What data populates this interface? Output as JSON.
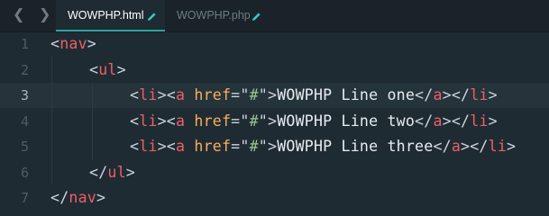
{
  "tabs": [
    {
      "label": "WOWPHP.html",
      "active": true
    },
    {
      "label": "WOWPHP.php",
      "active": false
    }
  ],
  "nav": {
    "back_icon": "chevron-left",
    "forward_icon": "chevron-right"
  },
  "gutter": {
    "lines": [
      "1",
      "2",
      "3",
      "4",
      "5",
      "6",
      "7"
    ],
    "current_line": 3
  },
  "code": {
    "line1": {
      "open": "<",
      "tag": "nav",
      "close": ">"
    },
    "line2": {
      "open": "<",
      "tag": "ul",
      "close": ">"
    },
    "line3": {
      "li_open": "<",
      "li": "li",
      "li_close": ">",
      "a_open": "<",
      "a": "a",
      "attr": "href",
      "eq": "=",
      "q1": "\"",
      "val": "#",
      "q2": "\"",
      "gt": ">",
      "text": "WOWPHP Line one",
      "a_end_open": "</",
      "a_end": "a",
      "a_end_close": ">",
      "li_end_open": "</",
      "li_end": "li",
      "li_end_close": ">"
    },
    "line4": {
      "li_open": "<",
      "li": "li",
      "li_close": ">",
      "a_open": "<",
      "a": "a",
      "attr": "href",
      "eq": "=",
      "q1": "\"",
      "val": "#",
      "q2": "\"",
      "gt": ">",
      "text": "WOWPHP Line two",
      "a_end_open": "</",
      "a_end": "a",
      "a_end_close": ">",
      "li_end_open": "</",
      "li_end": "li",
      "li_end_close": ">"
    },
    "line5": {
      "li_open": "<",
      "li": "li",
      "li_close": ">",
      "a_open": "<",
      "a": "a",
      "attr": "href",
      "eq": "=",
      "q1": "\"",
      "val": "#",
      "q2": "\"",
      "gt": ">",
      "text": "WOWPHP Line three",
      "a_end_open": "</",
      "a_end": "a",
      "a_end_close": ">",
      "li_end_open": "</",
      "li_end": "li",
      "li_end_close": ">"
    },
    "line6": {
      "open": "</",
      "tag": "ul",
      "close": ">"
    },
    "line7": {
      "open": "</",
      "tag": "nav",
      "close": ">"
    }
  },
  "colors": {
    "background": "#1f2b32",
    "tag": "#ec5f67",
    "attribute": "#f9ae58",
    "string": "#99c794",
    "text": "#e6ecef",
    "accent": "#2aa6a0"
  }
}
